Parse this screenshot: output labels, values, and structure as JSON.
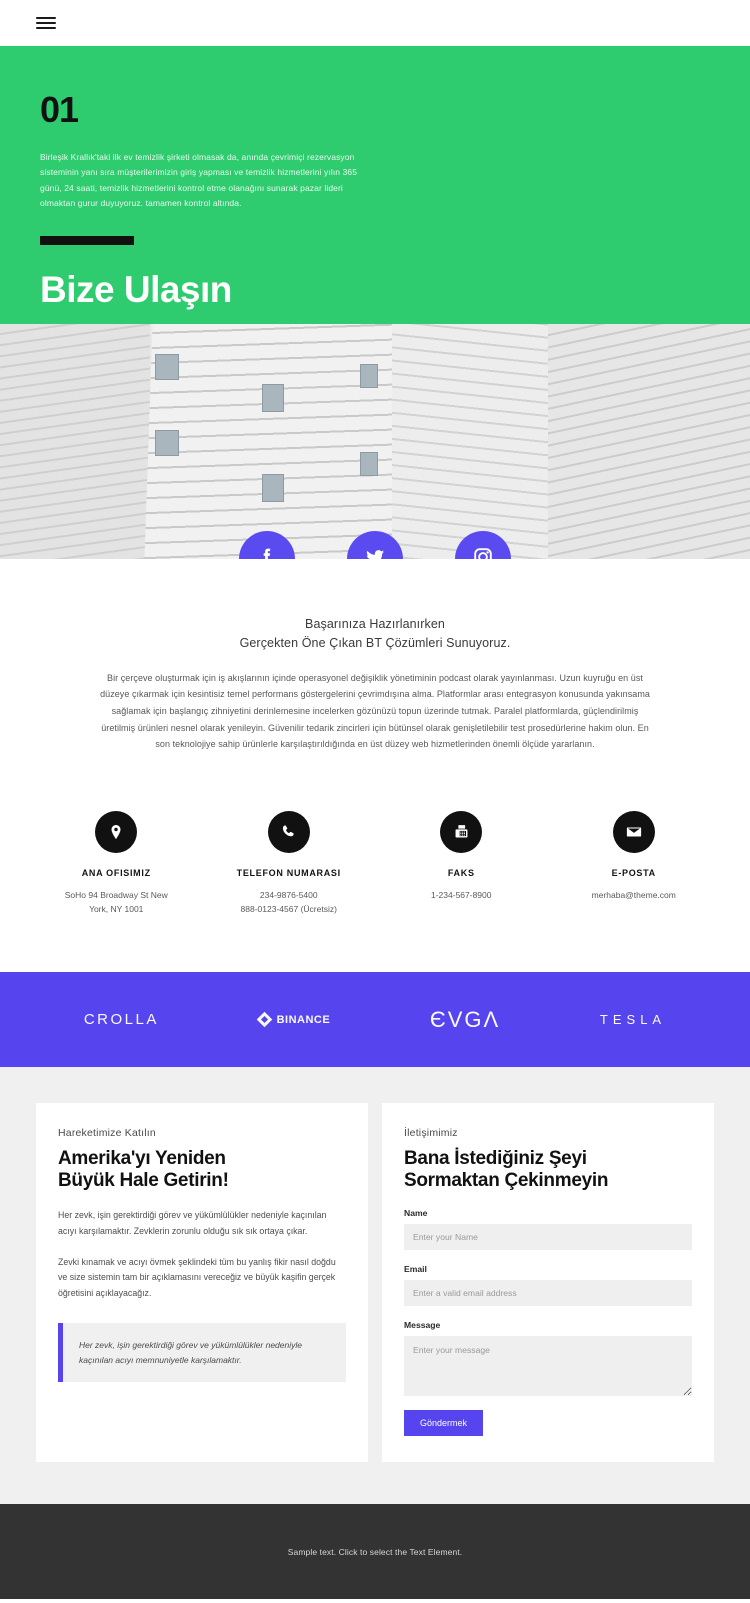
{
  "nav": {
    "menu_icon": "hamburger-icon"
  },
  "hero": {
    "number": "01",
    "paragraph": "Birleşik Krallık'taki ilk ev temizlik şirketi olmasak da, anında çevrimiçi rezervasyon sisteminin yanı sıra müşterilerimizin giriş yapması ve temizlik hizmetlerini yılın 365 günü, 24 saati, temizlik hizmetlerini kontrol etme olanağını sunarak pazar lideri olmaktan gurur duyuyoruz. tamamen kontrol altında.",
    "title": "Bize Ulaşın",
    "bg_color": "#2ecc6f"
  },
  "social": {
    "accent_color": "#5a4bf0",
    "items": [
      {
        "icon": "facebook-icon",
        "label": "Facebook"
      },
      {
        "icon": "twitter-icon",
        "label": "Twitter"
      },
      {
        "icon": "instagram-icon",
        "label": "Instagram"
      }
    ]
  },
  "intro": {
    "heading_line1": "Başarınıza Hazırlanırken",
    "heading_line2": "Gerçekten Öne Çıkan BT Çözümleri Sunuyoruz.",
    "paragraph": "Bir çerçeve oluşturmak için iş akışlarının içinde operasyonel değişiklik yönetiminin podcast olarak yayınlanması. Uzun kuyruğu en üst düzeye çıkarmak için kesintisiz temel performans göstergelerini çevrimdışına alma. Platformlar arası entegrasyon konusunda yakınsama sağlamak için başlangıç zihniyetini derinlemesine incelerken gözünüzü topun üzerinde tutmak. Paralel platformlarda, güçlendirilmiş üretilmiş ürünleri nesnel olarak yenileyin. Güvenilir tedarik zincirleri için bütünsel olarak genişletilebilir test prosedürlerine hakim olun. En son teknolojiye sahip ürünlerle karşılaştırıldığında en üst düzey web hizmetlerinden önemli ölçüde yararlanın."
  },
  "contacts": [
    {
      "icon": "location-pin-icon",
      "title": "ANA OFISIMIZ",
      "value_line1": "SoHo 94 Broadway St New",
      "value_line2": "York, NY 1001"
    },
    {
      "icon": "phone-icon",
      "title": "TELEFON NUMARASI",
      "value_line1": "234-9876-5400",
      "value_line2": "888-0123-4567 (Ücretsiz)"
    },
    {
      "icon": "fax-icon",
      "title": "FAKS",
      "value_line1": "1-234-567-8900",
      "value_line2": ""
    },
    {
      "icon": "envelope-icon",
      "title": "E-POSTA",
      "value_line1": "merhaba@theme.com",
      "value_line2": ""
    }
  ],
  "logos": {
    "bg_color": "#5644ef",
    "items": [
      {
        "name": "crolla-logo",
        "text": "CROLLA"
      },
      {
        "name": "binance-logo",
        "text": "BINANCE"
      },
      {
        "name": "evga-logo",
        "text": "ЄVGΛ"
      },
      {
        "name": "tesla-logo",
        "text": "TESLA"
      }
    ]
  },
  "left_card": {
    "eyebrow": "Hareketimize Katılın",
    "title_line1": "Amerika'yı Yeniden",
    "title_line2": "Büyük Hale Getirin!",
    "paragraph1": "Her zevk, işin gerektirdiği görev ve yükümlülükler nedeniyle kaçınılan acıyı karşılamaktır. Zevklerin zorunlu olduğu sık sık ortaya çıkar.",
    "paragraph2": "Zevki kınamak ve acıyı övmek şeklindeki tüm bu yanlış fikir nasıl doğdu ve size sistemin tam bir açıklamasını vereceğiz ve büyük kaşifin gerçek öğretisini açıklayacağız.",
    "quote": "Her zevk, işin gerektirdiği görev ve yükümlülükler nedeniyle kaçınılan acıyı memnuniyetle karşılamaktır.",
    "quote_accent": "#5644ef"
  },
  "form_card": {
    "eyebrow": "İletişimimiz",
    "title_line1": "Bana İstediğiniz Şeyi",
    "title_line2": "Sormaktan Çekinmeyin",
    "fields": [
      {
        "label": "Name",
        "placeholder": "Enter your Name",
        "value": ""
      },
      {
        "label": "Email",
        "placeholder": "Enter a valid email address",
        "value": ""
      },
      {
        "label": "Message",
        "placeholder": "Enter your message",
        "value": ""
      }
    ],
    "submit_label": "Göndermek",
    "submit_color": "#5644ef"
  },
  "footer": {
    "text": "Sample text. Click to select the Text Element.",
    "bg_color": "#333333"
  }
}
